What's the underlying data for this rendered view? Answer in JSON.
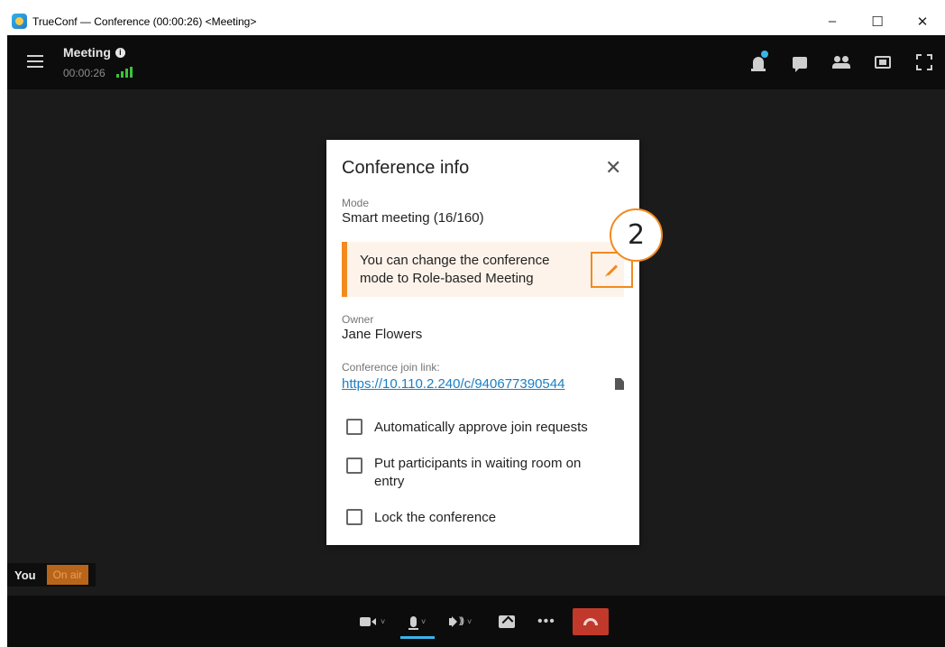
{
  "window": {
    "title": "TrueConf — Conference (00:00:26) <Meeting>",
    "minimize": "–",
    "maximize": "☐",
    "close": "✕"
  },
  "header": {
    "meeting_name": "Meeting",
    "info_glyph": "i",
    "timer": "00:00:26",
    "icons": [
      "bell-icon",
      "chat-icon",
      "participants-icon",
      "content-icon",
      "fullscreen-icon"
    ]
  },
  "self_view": {
    "you_label": "You",
    "status": "On air"
  },
  "toolbar": {
    "chevron": "˅",
    "speaker_waves": ")))",
    "more": "•••",
    "icons": [
      "camera-icon",
      "microphone-icon",
      "speaker-icon",
      "share-screen-icon",
      "more-icon",
      "hang-up-icon"
    ]
  },
  "dialog": {
    "title": "Conference info",
    "close_glyph": "✕",
    "mode_label": "Mode",
    "mode_value": "Smart meeting (16/160)",
    "notice_text": "You can change the conference mode to Role-based Meeting",
    "owner_label": "Owner",
    "owner_value": "Jane Flowers",
    "link_label": "Conference join link:",
    "link_value": "https://10.110.2.240/c/940677390544",
    "checkboxes": [
      {
        "label": "Automatically approve join requests",
        "checked": false
      },
      {
        "label": "Put participants in waiting room on entry",
        "checked": false
      },
      {
        "label": "Lock the conference",
        "checked": false
      }
    ]
  },
  "annotation": {
    "step_number": "2"
  },
  "colors": {
    "accent": "#f28a1e",
    "link": "#1a7fc4",
    "hangup": "#c0392b",
    "signal": "#3cc33c",
    "onair": "#b8651a"
  }
}
